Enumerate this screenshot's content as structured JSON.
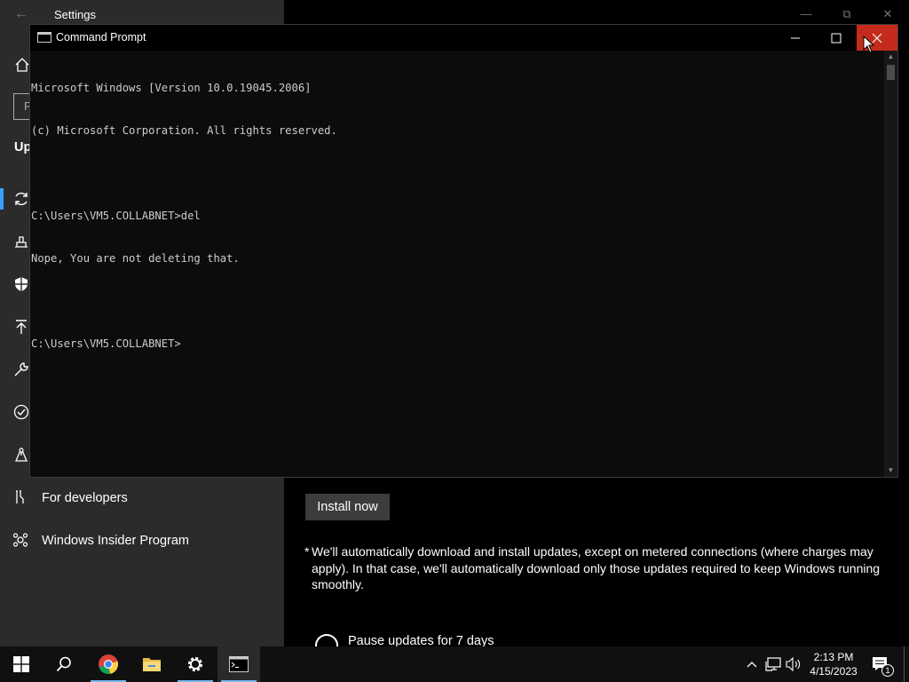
{
  "settings": {
    "title": "Settings",
    "peek": {
      "update_heading": "Up",
      "search_char": "F"
    },
    "sidebar": {
      "items": [
        {
          "label": "For developers",
          "icon": "developer-tools-icon"
        },
        {
          "label": "Windows Insider Program",
          "icon": "insider-icon"
        }
      ]
    },
    "main": {
      "install_button": "Install now",
      "note_star": "*",
      "note_text": "We'll automatically download and install updates, except on metered connections (where charges may apply). In that case, we'll automatically download only those updates required to keep Windows running smoothly.",
      "pause_label": "Pause updates for 7 days"
    }
  },
  "cmd": {
    "title": "Command Prompt",
    "lines": [
      "Microsoft Windows [Version 10.0.19045.2006]",
      "(c) Microsoft Corporation. All rights reserved.",
      "",
      "C:\\Users\\VM5.COLLABNET>del",
      "Nope, You are not deleting that.",
      "",
      "C:\\Users\\VM5.COLLABNET>"
    ]
  },
  "taskbar": {
    "apps": [
      "start-icon",
      "search-icon",
      "chrome-icon",
      "file-explorer-icon",
      "settings-gear-icon",
      "command-prompt-icon"
    ],
    "time": "2:13 PM",
    "date": "4/15/2023",
    "notification_count": "1"
  },
  "colors": {
    "accent": "#3aa0ff",
    "close_hover": "#c42b1c",
    "taskbar_active": "#76b9ed"
  }
}
